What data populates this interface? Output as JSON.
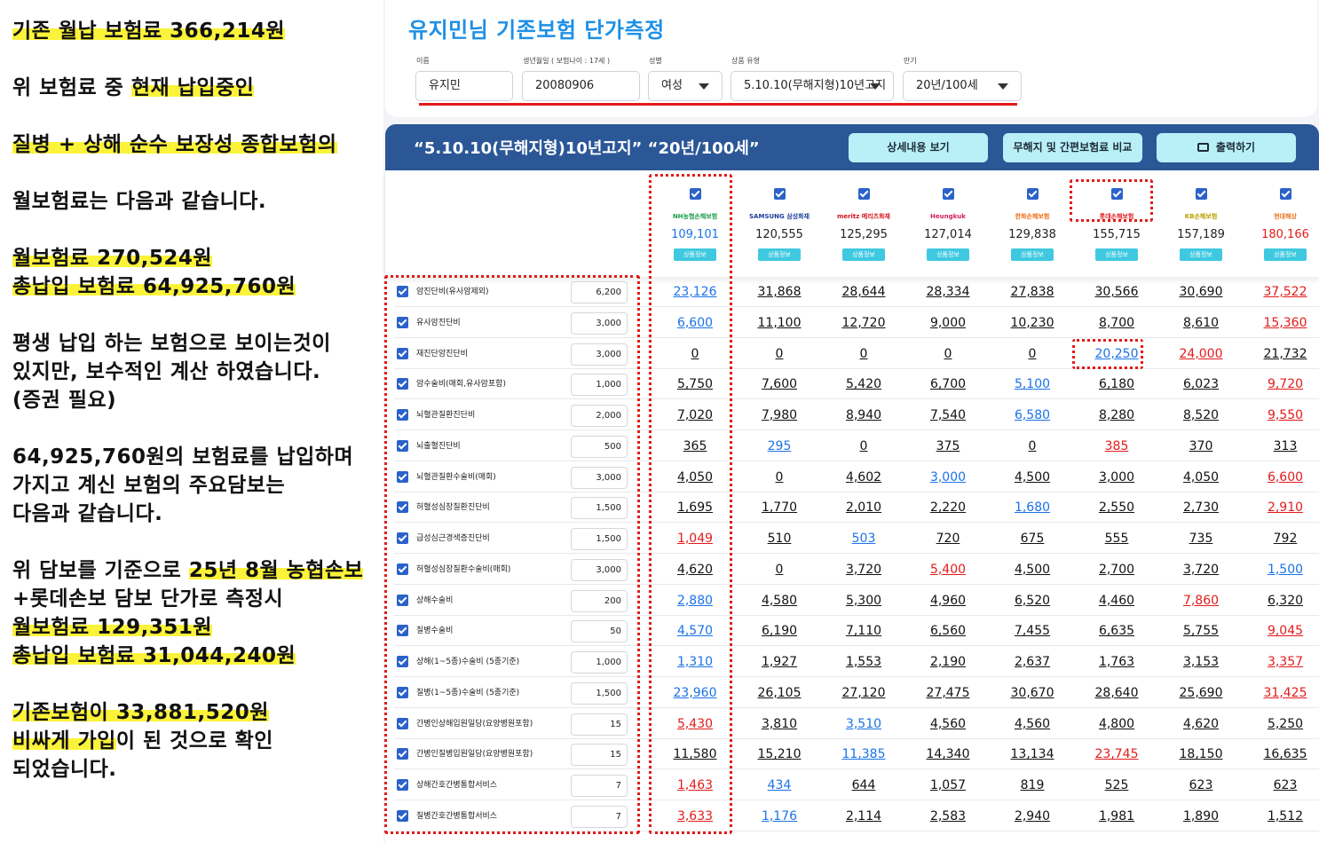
{
  "notes": {
    "l1": [
      "기존 월납 보험료 366,214원",
      ""
    ],
    "l2": [
      "위 보험료 중 ",
      "현재 납입중인"
    ],
    "l3": [
      "질병 + 상해 순수 보장성 종합보험의",
      ""
    ],
    "l4": "월보험료는 다음과 같습니다.",
    "l5": "월보험료 270,524원",
    "l6": "총납입 보험료 64,925,760원",
    "l7": "평생 납입 하는 보험으로 보이는것이",
    "l8": "있지만, 보수적인 계산 하였습니다.",
    "l9": "(증권 필요)",
    "l10": "64,925,760원의 보험료를 납입하며",
    "l11": "가지고 계신 보험의 주요담보는",
    "l12": "다음과 같습니다.",
    "l13": [
      "위 담보를 기준으로 ",
      "25년 8월 농협손보"
    ],
    "l14": "+롯데손보 담보 단가로 측정시",
    "l15": "월보험료 129,351원",
    "l16": "총납입 보험료 31,044,240원",
    "l17": "기존보험이 33,881,520원",
    "l18": [
      "비싸게 가입",
      "이 된 것으로 확인"
    ],
    "l19": "되었습니다."
  },
  "header": {
    "title": "유지민님 기존보험 단가측정",
    "fields": {
      "name_label": "이름",
      "name_value": "유지민",
      "birth_label": "생년월일 ( 보험나이 : 17세 )",
      "birth_value": "20080906",
      "gender_label": "성별",
      "gender_value": "여성",
      "product_label": "상품 유형",
      "product_value": "5.10.10(무해지형)10년고지",
      "term_label": "만기",
      "term_value": "20년/100세"
    }
  },
  "bar": {
    "title": "“5.10.10(무해지형)10년고지” “20년/100세”",
    "detail_button": "상세내용 보기",
    "compare_button": "무해지 및 간편보험료 비교",
    "print_button": "출력하기"
  },
  "companies": [
    {
      "logo": "NH농협손해보험",
      "logo_color": "#1a9e4a",
      "premium": "109,101",
      "premium_color": "blue",
      "info": "상품정보"
    },
    {
      "logo": "SAMSUNG 삼성화재",
      "logo_color": "#1d3e9a",
      "premium": "120,555",
      "premium_color": "",
      "info": "상품정보"
    },
    {
      "logo": "meritz 메리츠화재",
      "logo_color": "#d4151b",
      "premium": "125,295",
      "premium_color": "",
      "info": "상품정보"
    },
    {
      "logo": "Heungkuk",
      "logo_color": "#d61f5a",
      "premium": "127,014",
      "premium_color": "",
      "info": "상품정보"
    },
    {
      "logo": "한화손해보험",
      "logo_color": "#f06b12",
      "premium": "129,838",
      "premium_color": "",
      "info": "상품정보"
    },
    {
      "logo": "롯데손해보험",
      "logo_color": "#e31b1b",
      "premium": "155,715",
      "premium_color": "",
      "info": "상품정보"
    },
    {
      "logo": "KB손해보험",
      "logo_color": "#b8a000",
      "premium": "157,189",
      "premium_color": "",
      "info": "상품정보"
    },
    {
      "logo": "현대해상",
      "logo_color": "#e8731a",
      "premium": "180,166",
      "premium_color": "red",
      "info": "상품정보"
    }
  ],
  "coverages": [
    {
      "name": "암진단비(유사암제외)",
      "amount": "6,200",
      "values": [
        "23,126",
        "31,868",
        "28,644",
        "28,334",
        "27,838",
        "30,566",
        "30,690",
        "37,522"
      ],
      "colors": [
        "blue",
        "",
        "",
        "",
        "",
        "",
        "",
        "red"
      ]
    },
    {
      "name": "유사암진단비",
      "amount": "3,000",
      "values": [
        "6,600",
        "11,100",
        "12,720",
        "9,000",
        "10,230",
        "8,700",
        "8,610",
        "15,360"
      ],
      "colors": [
        "blue",
        "",
        "",
        "",
        "",
        "",
        "",
        "red"
      ]
    },
    {
      "name": "재진단암진단비",
      "amount": "3,000",
      "values": [
        "0",
        "0",
        "0",
        "0",
        "0",
        "20,250",
        "24,000",
        "21,732"
      ],
      "colors": [
        "",
        "",
        "",
        "",
        "",
        "blue",
        "red",
        ""
      ]
    },
    {
      "name": "암수술비(매회,유사암포함)",
      "amount": "1,000",
      "values": [
        "5,750",
        "7,600",
        "5,420",
        "6,700",
        "5,100",
        "6,180",
        "6,023",
        "9,720"
      ],
      "colors": [
        "",
        "",
        "",
        "",
        "blue",
        "",
        "",
        "red"
      ]
    },
    {
      "name": "뇌혈관질환진단비",
      "amount": "2,000",
      "values": [
        "7,020",
        "7,980",
        "8,940",
        "7,540",
        "6,580",
        "8,280",
        "8,520",
        "9,550"
      ],
      "colors": [
        "",
        "",
        "",
        "",
        "blue",
        "",
        "",
        "red"
      ]
    },
    {
      "name": "뇌출혈진단비",
      "amount": "500",
      "values": [
        "365",
        "295",
        "0",
        "375",
        "0",
        "385",
        "370",
        "313"
      ],
      "colors": [
        "",
        "blue",
        "",
        "",
        "",
        "red",
        "",
        ""
      ]
    },
    {
      "name": "뇌혈관질환수술비(매회)",
      "amount": "3,000",
      "values": [
        "4,050",
        "0",
        "4,602",
        "3,000",
        "4,500",
        "3,000",
        "4,050",
        "6,600"
      ],
      "colors": [
        "",
        "",
        "",
        "blue",
        "",
        "",
        "",
        "red"
      ]
    },
    {
      "name": "허혈성심장질환진단비",
      "amount": "1,500",
      "values": [
        "1,695",
        "1,770",
        "2,010",
        "2,220",
        "1,680",
        "2,550",
        "2,730",
        "2,910"
      ],
      "colors": [
        "",
        "",
        "",
        "",
        "blue",
        "",
        "",
        "red"
      ]
    },
    {
      "name": "급성심근경색증진단비",
      "amount": "1,500",
      "values": [
        "1,049",
        "510",
        "503",
        "720",
        "675",
        "555",
        "735",
        "792"
      ],
      "colors": [
        "red",
        "",
        "blue",
        "",
        "",
        "",
        "",
        ""
      ]
    },
    {
      "name": "허혈성심장질환수술비(매회)",
      "amount": "3,000",
      "values": [
        "4,620",
        "0",
        "3,720",
        "5,400",
        "4,500",
        "2,700",
        "3,720",
        "1,500"
      ],
      "colors": [
        "",
        "",
        "",
        "red",
        "",
        "",
        "",
        "blue"
      ]
    },
    {
      "name": "상해수술비",
      "amount": "200",
      "values": [
        "2,880",
        "4,580",
        "5,300",
        "4,960",
        "6,520",
        "4,460",
        "7,860",
        "6,320"
      ],
      "colors": [
        "blue",
        "",
        "",
        "",
        "",
        "",
        "red",
        ""
      ]
    },
    {
      "name": "질병수술비",
      "amount": "50",
      "values": [
        "4,570",
        "6,190",
        "7,110",
        "6,560",
        "7,455",
        "6,635",
        "5,755",
        "9,045"
      ],
      "colors": [
        "blue",
        "",
        "",
        "",
        "",
        "",
        "",
        "red"
      ]
    },
    {
      "name": "상해(1~5종)수술비 (5종기준)",
      "amount": "1,000",
      "values": [
        "1,310",
        "1,927",
        "1,553",
        "2,190",
        "2,637",
        "1,763",
        "3,153",
        "3,357"
      ],
      "colors": [
        "blue",
        "",
        "",
        "",
        "",
        "",
        "",
        "red"
      ]
    },
    {
      "name": "질병(1~5종)수술비 (5종기준)",
      "amount": "1,500",
      "values": [
        "23,960",
        "26,105",
        "27,120",
        "27,475",
        "30,670",
        "28,640",
        "25,690",
        "31,425"
      ],
      "colors": [
        "blue",
        "",
        "",
        "",
        "",
        "",
        "",
        "red"
      ]
    },
    {
      "name": "간병인상해입원일당(요양병원포함)",
      "amount": "15",
      "values": [
        "5,430",
        "3,810",
        "3,510",
        "4,560",
        "4,560",
        "4,800",
        "4,620",
        "5,250"
      ],
      "colors": [
        "red",
        "",
        "blue",
        "",
        "",
        "",
        "",
        ""
      ]
    },
    {
      "name": "간병인질병입원일당(요양병원포함)",
      "amount": "15",
      "values": [
        "11,580",
        "15,210",
        "11,385",
        "14,340",
        "13,134",
        "23,745",
        "18,150",
        "16,635"
      ],
      "colors": [
        "",
        "",
        "blue",
        "",
        "",
        "red",
        "",
        ""
      ]
    },
    {
      "name": "상해간호간병통합서비스",
      "amount": "7",
      "values": [
        "1,463",
        "434",
        "644",
        "1,057",
        "819",
        "525",
        "623",
        "623"
      ],
      "colors": [
        "red",
        "blue",
        "",
        "",
        "",
        "",
        "",
        ""
      ]
    },
    {
      "name": "질병간호간병통합서비스",
      "amount": "7",
      "values": [
        "3,633",
        "1,176",
        "2,114",
        "2,583",
        "2,940",
        "1,981",
        "1,890",
        "1,512"
      ],
      "colors": [
        "red",
        "blue",
        "",
        "",
        "",
        "",
        "",
        ""
      ]
    }
  ]
}
